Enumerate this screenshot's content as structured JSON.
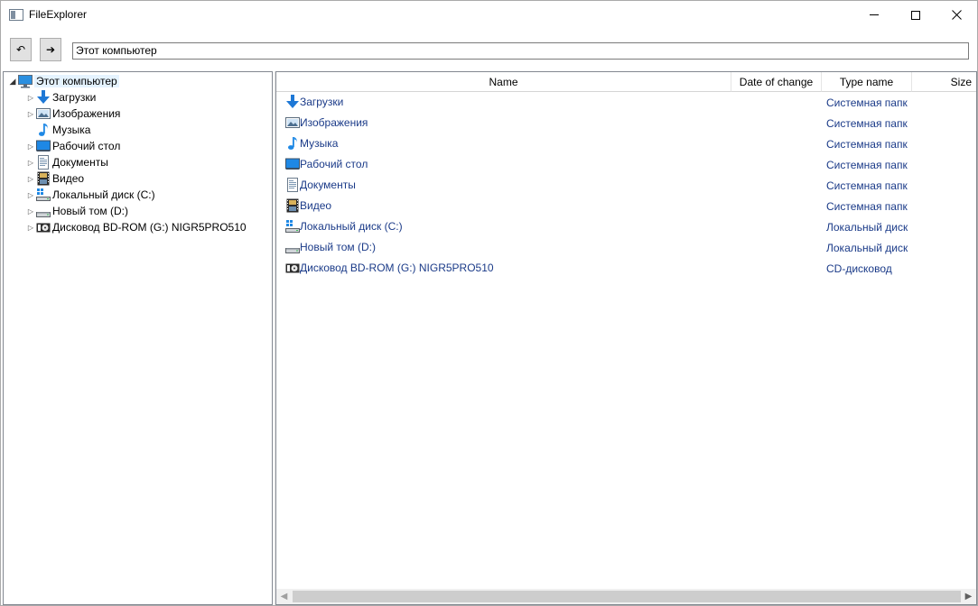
{
  "window": {
    "title": "FileExplorer",
    "min_icon": "minimize-icon",
    "max_icon": "maximize-icon",
    "close_icon": "close-icon"
  },
  "toolbar": {
    "back_icon": "back-arrow-icon",
    "back_glyph": "↶",
    "forward_icon": "forward-arrow-icon",
    "forward_glyph": "➔",
    "address_value": "Этот компьютер"
  },
  "tree": {
    "root": {
      "label": "Этот компьютер",
      "icon": "computer-icon",
      "expanded": true
    },
    "items": [
      {
        "label": "Загрузки",
        "icon": "download-icon",
        "expandable": true
      },
      {
        "label": "Изображения",
        "icon": "pictures-icon",
        "expandable": true
      },
      {
        "label": "Музыка",
        "icon": "music-icon",
        "expandable": false
      },
      {
        "label": "Рабочий стол",
        "icon": "desktop-icon",
        "expandable": true
      },
      {
        "label": "Документы",
        "icon": "documents-icon",
        "expandable": true
      },
      {
        "label": "Видео",
        "icon": "video-icon",
        "expandable": true
      },
      {
        "label": "Локальный диск (C:)",
        "icon": "system-drive-icon",
        "expandable": true
      },
      {
        "label": "Новый том (D:)",
        "icon": "drive-icon",
        "expandable": true
      },
      {
        "label": "Дисковод BD-ROM (G:) NIGR5PRO510",
        "icon": "optical-drive-icon",
        "expandable": true
      }
    ]
  },
  "list": {
    "columns": {
      "name": "Name",
      "date": "Date of change",
      "type": "Type name",
      "size": "Size"
    },
    "rows": [
      {
        "name": "Загрузки",
        "icon": "download-icon",
        "type": "Системная папк"
      },
      {
        "name": "Изображения",
        "icon": "pictures-icon",
        "type": "Системная папк"
      },
      {
        "name": "Музыка",
        "icon": "music-icon",
        "type": "Системная папк"
      },
      {
        "name": "Рабочий стол",
        "icon": "desktop-icon",
        "type": "Системная папк"
      },
      {
        "name": "Документы",
        "icon": "documents-icon",
        "type": "Системная папк"
      },
      {
        "name": "Видео",
        "icon": "video-icon",
        "type": "Системная папк"
      },
      {
        "name": "Локальный диск (C:)",
        "icon": "system-drive-icon",
        "type": "Локальный диск"
      },
      {
        "name": "Новый том (D:)",
        "icon": "drive-icon",
        "type": "Локальный диск"
      },
      {
        "name": "Дисковод BD-ROM (G:) NIGR5PRO510",
        "icon": "optical-drive-icon",
        "type": "CD-дисковод"
      }
    ]
  },
  "colors": {
    "link_text": "#1a3a88",
    "selection": "#e5f3ff",
    "icon_blue": "#1e88e5"
  }
}
